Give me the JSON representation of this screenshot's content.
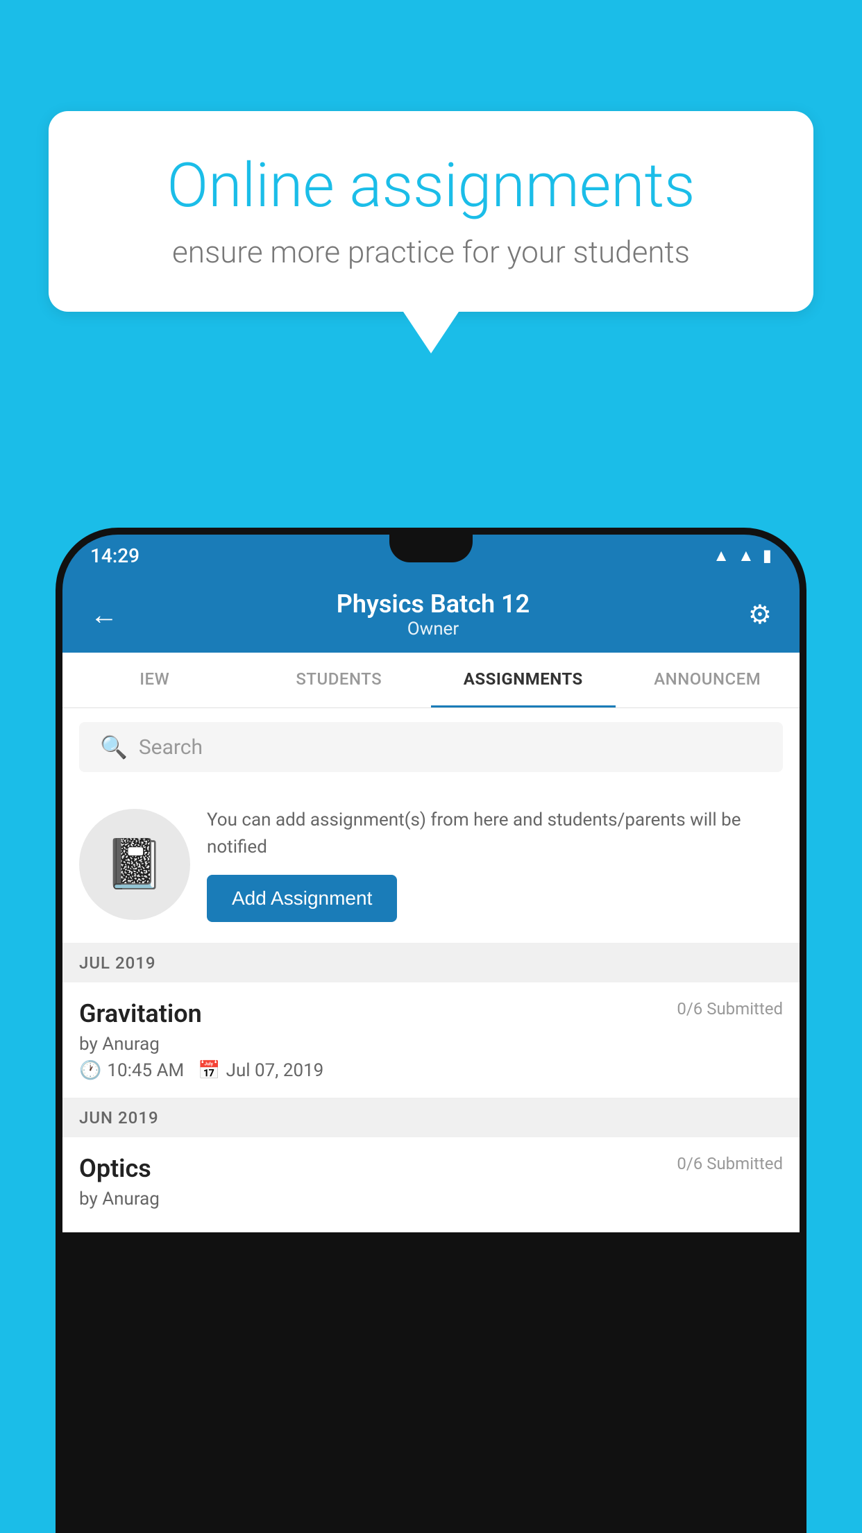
{
  "background": {
    "color": "#1bbde8"
  },
  "speech_bubble": {
    "title": "Online assignments",
    "subtitle": "ensure more practice for your students"
  },
  "phone": {
    "status_bar": {
      "time": "14:29",
      "wifi_icon": "wifi",
      "signal_icon": "signal",
      "battery_icon": "battery"
    },
    "app_bar": {
      "title": "Physics Batch 12",
      "subtitle": "Owner",
      "back_icon": "←",
      "settings_icon": "⚙"
    },
    "tabs": [
      {
        "label": "IEW",
        "active": false
      },
      {
        "label": "STUDENTS",
        "active": false
      },
      {
        "label": "ASSIGNMENTS",
        "active": true
      },
      {
        "label": "ANNOUNCEM",
        "active": false
      }
    ],
    "search": {
      "placeholder": "Search"
    },
    "promo": {
      "description": "You can add assignment(s) from here and students/parents will be notified",
      "add_button_label": "Add Assignment"
    },
    "sections": [
      {
        "month_label": "JUL 2019",
        "assignments": [
          {
            "name": "Gravitation",
            "submitted": "0/6 Submitted",
            "by": "by Anurag",
            "time": "10:45 AM",
            "date": "Jul 07, 2019"
          }
        ]
      },
      {
        "month_label": "JUN 2019",
        "assignments": [
          {
            "name": "Optics",
            "submitted": "0/6 Submitted",
            "by": "by Anurag",
            "time": "",
            "date": ""
          }
        ]
      }
    ]
  }
}
